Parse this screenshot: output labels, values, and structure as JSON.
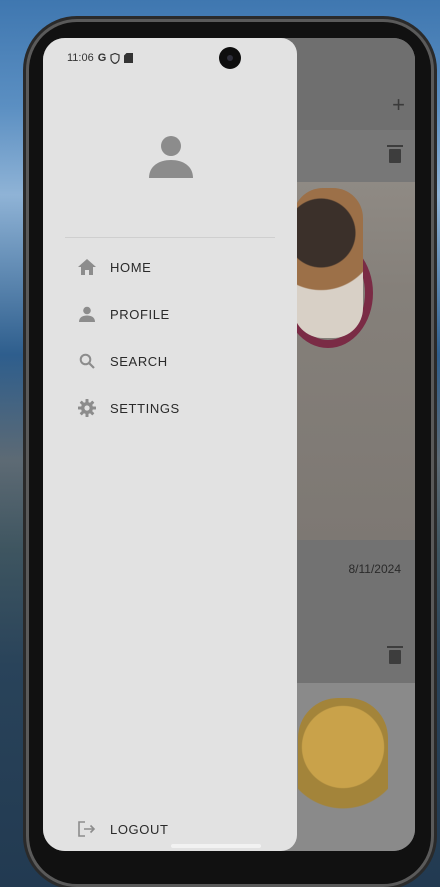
{
  "status_bar": {
    "time": "11:06",
    "icons": [
      "google-icon",
      "vpn-shield-icon",
      "sd-card-icon"
    ],
    "right_icons": [
      "wifi-icon",
      "signal-icon",
      "battery-icon"
    ]
  },
  "background_app": {
    "add_icon": "plus-icon",
    "delete_icon": "trash-icon",
    "post_date": "8/11/2024"
  },
  "drawer": {
    "avatar_icon": "user-avatar-icon",
    "items": [
      {
        "label": "HOME",
        "icon": "home-icon"
      },
      {
        "label": "PROFILE",
        "icon": "person-icon"
      },
      {
        "label": "SEARCH",
        "icon": "search-icon"
      },
      {
        "label": "SETTINGS",
        "icon": "gear-icon"
      }
    ],
    "logout": {
      "label": "LOGOUT",
      "icon": "logout-icon"
    }
  },
  "colors": {
    "drawer_bg": "#e2e2e2",
    "icon_gray": "#8c8c8c",
    "text": "#2a2a2a"
  }
}
